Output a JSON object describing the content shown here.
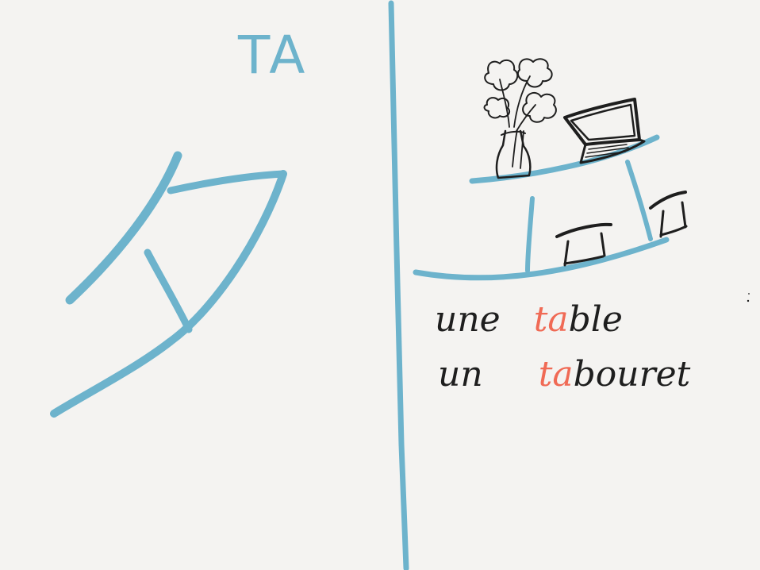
{
  "romaji": "TA",
  "kana": "タ",
  "words": [
    {
      "article": "une",
      "highlight": "ta",
      "rest": "ble"
    },
    {
      "article": "un",
      "highlight": "ta",
      "rest": "bouret"
    }
  ],
  "colors": {
    "background": "#f4f3f1",
    "stroke_blue": "#6db3cc",
    "ink": "#1e1e1e",
    "highlight": "#f06a55"
  },
  "drawings": [
    "katakana-ta",
    "table",
    "stool",
    "vase-with-flowers",
    "laptop"
  ]
}
